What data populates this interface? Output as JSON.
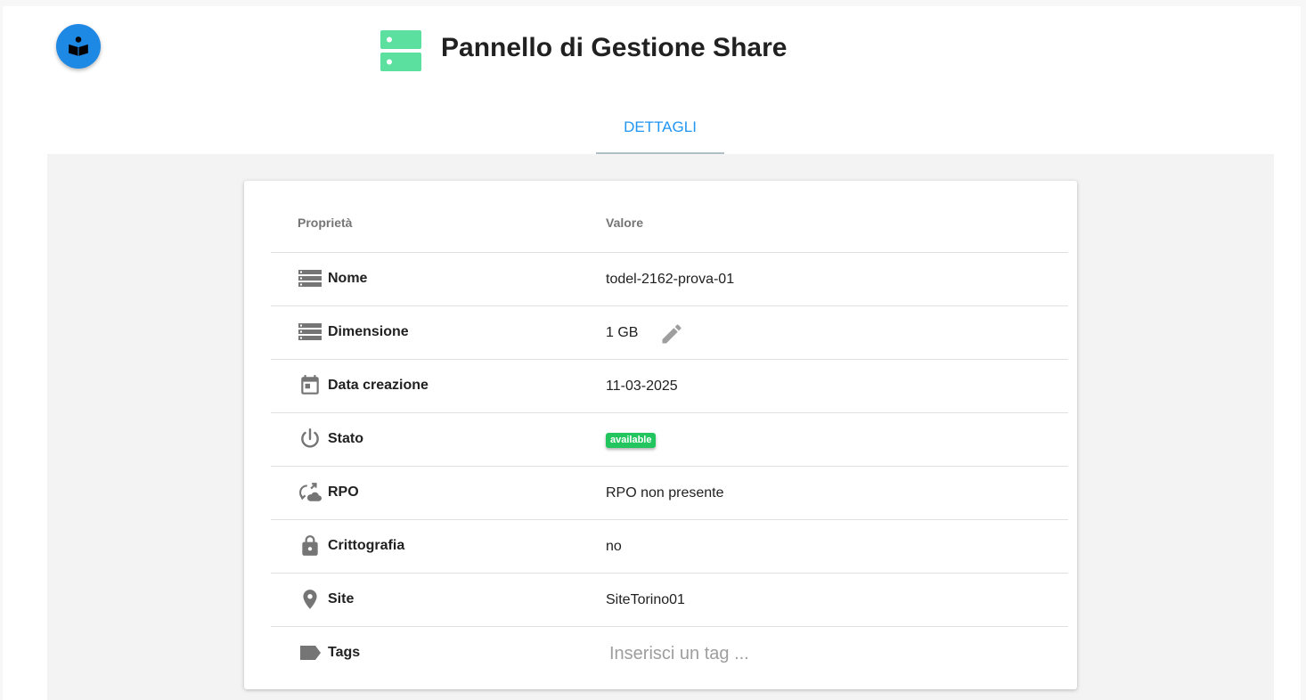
{
  "header": {
    "title": "Pannello di Gestione Share",
    "icon": "storage-icon",
    "accent": "#5ce0a0",
    "help_icon": "book-reader-icon",
    "help_color": "#1e88e5"
  },
  "tabs": [
    {
      "label": "DETTAGLI",
      "active": true
    }
  ],
  "table": {
    "headers": {
      "property": "Proprietà",
      "value": "Valore"
    },
    "rows": [
      {
        "icon": "storage-icon",
        "label": "Nome",
        "value": "todel-2162-prova-01"
      },
      {
        "icon": "storage-icon",
        "label": "Dimensione",
        "value": "1 GB",
        "edit_icon": "pencil-icon"
      },
      {
        "icon": "calendar-icon",
        "label": "Data creazione",
        "value": "11-03-2025"
      },
      {
        "icon": "power-icon",
        "label": "Stato",
        "badge": "available",
        "badge_color": "#22c55e"
      },
      {
        "icon": "sync-cloud-icon",
        "label": "RPO",
        "value": "RPO non presente"
      },
      {
        "icon": "lock-icon",
        "label": "Crittografia",
        "value": "no"
      },
      {
        "icon": "location-pin-icon",
        "label": "Site",
        "value": "SiteTorino01"
      },
      {
        "icon": "tag-icon",
        "label": "Tags",
        "placeholder": "Inserisci un tag ..."
      }
    ]
  }
}
